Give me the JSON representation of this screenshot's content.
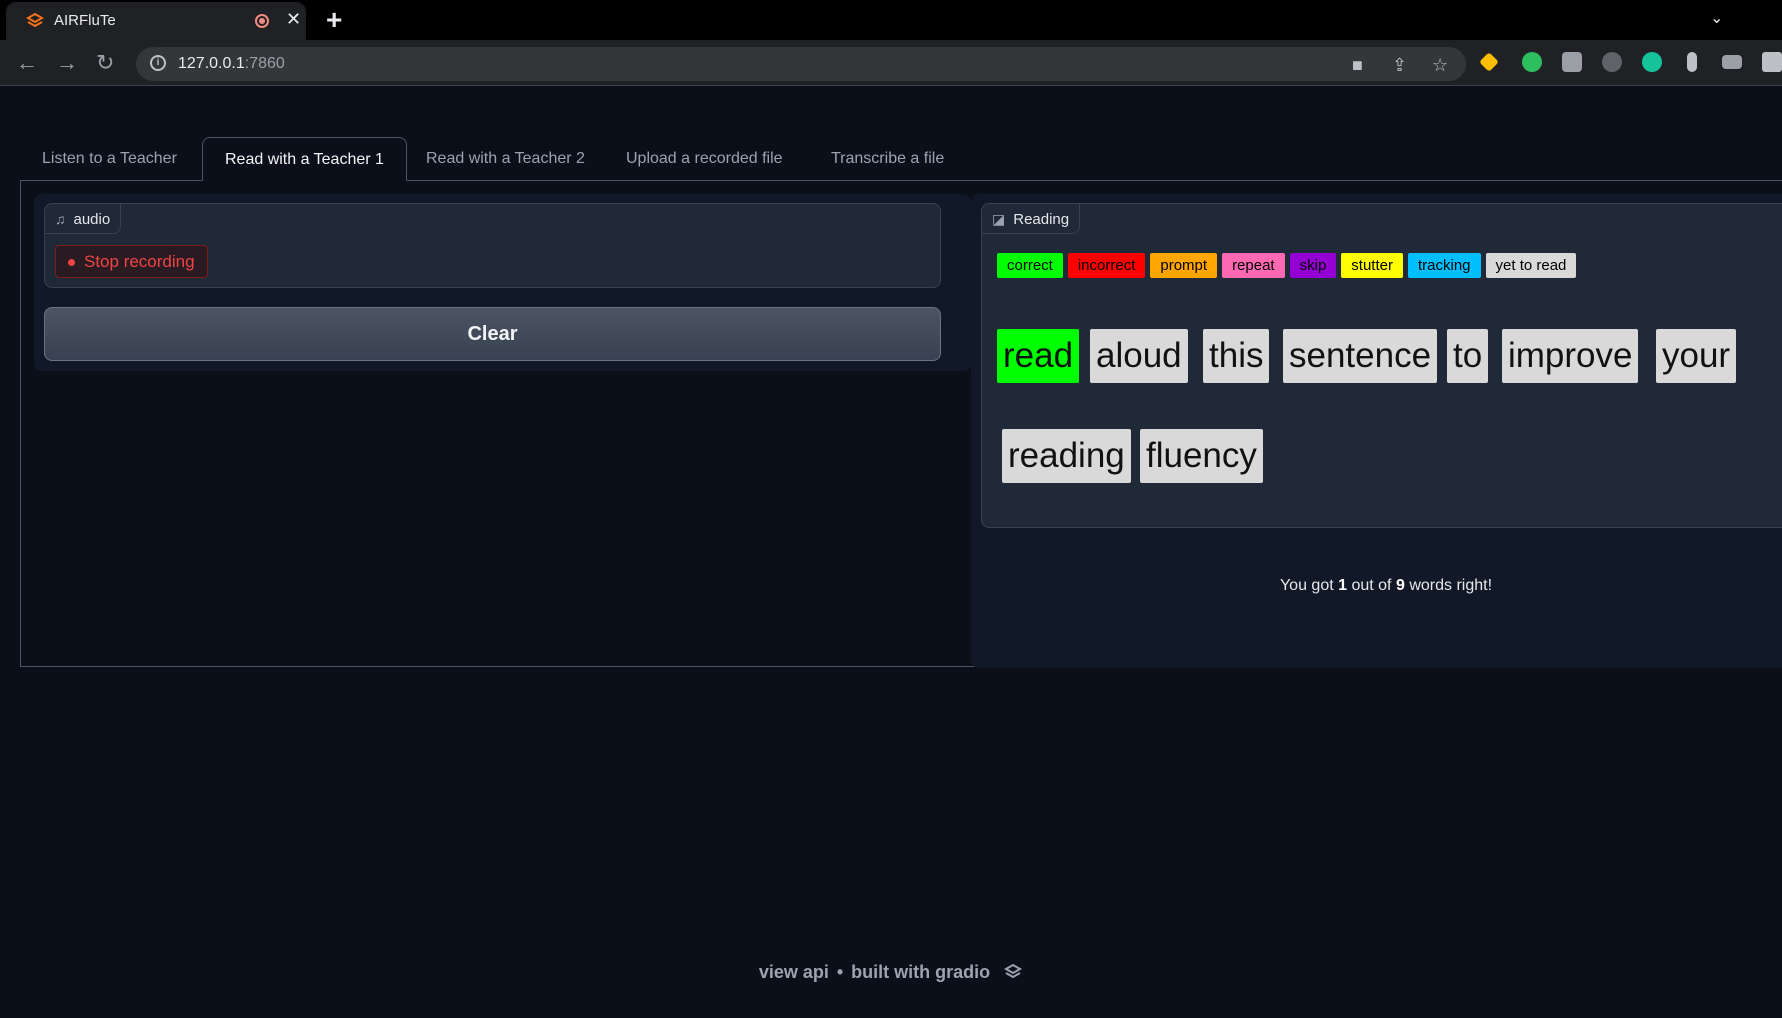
{
  "browser": {
    "tab_title": "AIRFluTe",
    "new_tab": "+",
    "close": "✕",
    "url_host": "127.0.0.1",
    "url_port": ":7860"
  },
  "tabs": [
    {
      "label": "Listen to a Teacher",
      "active": false
    },
    {
      "label": "Read with a Teacher 1",
      "active": true
    },
    {
      "label": "Read with a Teacher 2",
      "active": false
    },
    {
      "label": "Upload a recorded file",
      "active": false
    },
    {
      "label": "Transcribe a file",
      "active": false
    }
  ],
  "audio": {
    "label": "audio",
    "stop_label": "Stop recording",
    "clear_label": "Clear"
  },
  "reading": {
    "label": "Reading",
    "legend": [
      {
        "text": "correct",
        "color": "#00ff00"
      },
      {
        "text": "incorrect",
        "color": "#ff0000"
      },
      {
        "text": "prompt",
        "color": "#ffa500"
      },
      {
        "text": "repeat",
        "color": "#ff69b4"
      },
      {
        "text": "skip",
        "color": "#9400d3"
      },
      {
        "text": "stutter",
        "color": "#ffff00"
      },
      {
        "text": "tracking",
        "color": "#00bfff"
      },
      {
        "text": "yet to read",
        "color": "#d9d9d9"
      }
    ],
    "words": [
      {
        "text": "read",
        "status": "correct"
      },
      {
        "text": "aloud",
        "status": "yet to read"
      },
      {
        "text": "this",
        "status": "yet to read"
      },
      {
        "text": "sentence",
        "status": "yet to read"
      },
      {
        "text": "to",
        "status": "yet to read"
      },
      {
        "text": "improve",
        "status": "yet to read"
      },
      {
        "text": "your",
        "status": "yet to read"
      },
      {
        "text": "reading",
        "status": "yet to read"
      },
      {
        "text": "fluency",
        "status": "yet to read"
      }
    ],
    "result_prefix": "You got",
    "result_correct": "1",
    "result_mid": "out of",
    "result_total": "9",
    "result_suffix": "words right!"
  },
  "footer": {
    "view_api": "view api",
    "separator": "•",
    "built_with": "built with gradio"
  }
}
